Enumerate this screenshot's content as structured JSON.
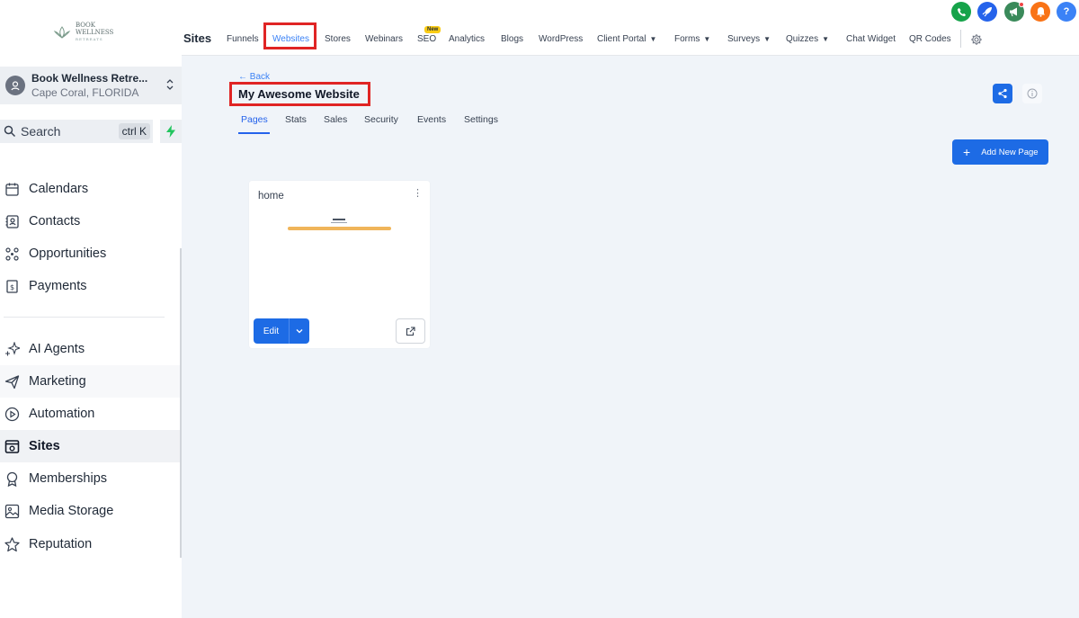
{
  "brand": {
    "logo_line1": "BOOK WELLNESS",
    "logo_line2": "RETREATS"
  },
  "account": {
    "name": "Book Wellness Retre...",
    "location": "Cape Coral, FLORIDA"
  },
  "search": {
    "label": "Search",
    "shortcut": "ctrl K"
  },
  "sidebar": {
    "items": [
      {
        "label": "Calendars",
        "icon": "calendar-icon"
      },
      {
        "label": "Contacts",
        "icon": "contacts-icon"
      },
      {
        "label": "Opportunities",
        "icon": "opportunities-icon"
      },
      {
        "label": "Payments",
        "icon": "payments-icon"
      },
      {
        "label": "AI Agents",
        "icon": "sparkle-icon"
      },
      {
        "label": "Marketing",
        "icon": "send-icon"
      },
      {
        "label": "Automation",
        "icon": "automation-icon"
      },
      {
        "label": "Sites",
        "icon": "sites-icon"
      },
      {
        "label": "Memberships",
        "icon": "award-icon"
      },
      {
        "label": "Media Storage",
        "icon": "image-icon"
      },
      {
        "label": "Reputation",
        "icon": "star-icon"
      }
    ],
    "active": "Sites"
  },
  "topbar": {
    "title": "Sites",
    "tabs": [
      {
        "label": "Funnels"
      },
      {
        "label": "Websites"
      },
      {
        "label": "Stores"
      },
      {
        "label": "Webinars"
      },
      {
        "label": "SEO",
        "badge": "New"
      },
      {
        "label": "Analytics"
      },
      {
        "label": "Blogs"
      },
      {
        "label": "WordPress"
      },
      {
        "label": "Client Portal",
        "dropdown": true
      },
      {
        "label": "Forms",
        "dropdown": true
      },
      {
        "label": "Surveys",
        "dropdown": true
      },
      {
        "label": "Quizzes",
        "dropdown": true
      },
      {
        "label": "Chat Widget"
      },
      {
        "label": "QR Codes"
      }
    ],
    "active_tab": "Websites",
    "help_label": "?",
    "colors": {
      "phone": "#16a34a",
      "rocket": "#2563eb",
      "megaphone": "#3a8a5a",
      "bell": "#f97316",
      "help": "#3b82f6"
    }
  },
  "website": {
    "back_label": "← Back",
    "title": "My Awesome Website",
    "subtabs": [
      "Pages",
      "Stats",
      "Sales",
      "Security",
      "Events",
      "Settings"
    ],
    "active_subtab": "Pages",
    "add_page_label": "Add New Page"
  },
  "pages": [
    {
      "name": "home",
      "edit_label": "Edit"
    }
  ],
  "accent_color": "#1d6be5",
  "highlight_color": "#e02424"
}
